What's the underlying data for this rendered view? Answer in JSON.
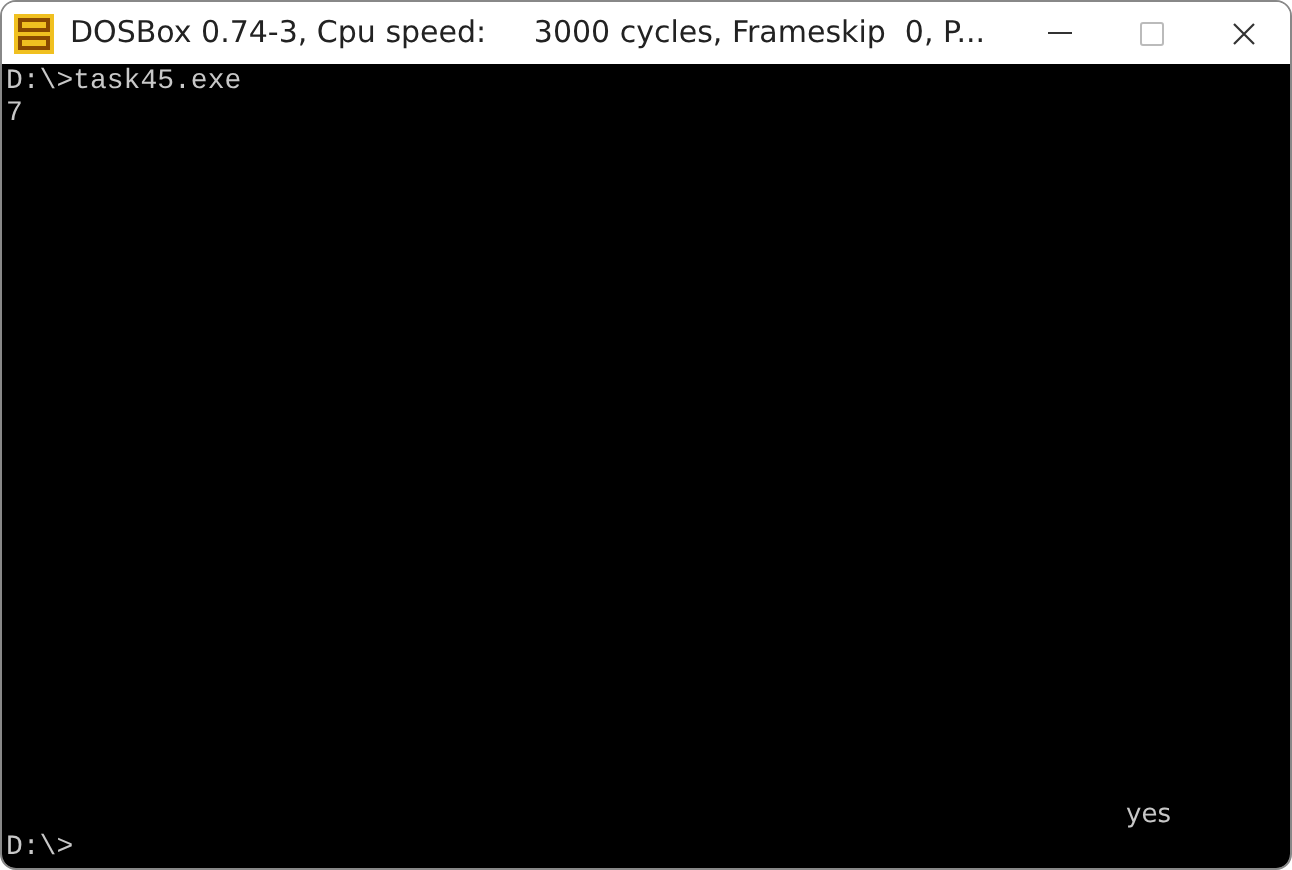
{
  "window": {
    "title": "DOSBox 0.74-3, Cpu speed:     3000 cycles, Frameskip  0, P..."
  },
  "console": {
    "lines": [
      "D:\\>task45.exe",
      "7"
    ],
    "overlay_text": "yes",
    "prompt": "D:\\>"
  }
}
